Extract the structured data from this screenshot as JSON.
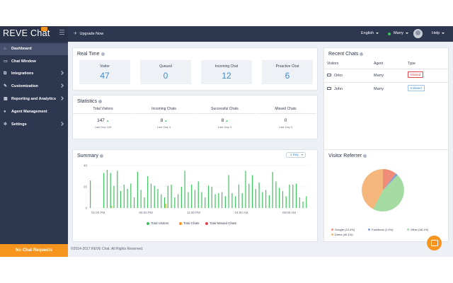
{
  "brand": {
    "name": "REVE Chat"
  },
  "sidebar": {
    "items": [
      {
        "label": "Dashboard",
        "icon": "home-icon"
      },
      {
        "label": "Chat Window",
        "icon": "chat-icon"
      },
      {
        "label": "Integrations",
        "icon": "plug-icon"
      },
      {
        "label": "Customization",
        "icon": "brush-icon"
      },
      {
        "label": "Reporting and Analytics",
        "icon": "chart-icon"
      },
      {
        "label": "Agent Management",
        "icon": "user-icon"
      },
      {
        "label": "Settings",
        "icon": "gear-icon"
      }
    ],
    "no_chat": "No Chat Requests"
  },
  "topbar": {
    "upgrade": "Upgrade Now",
    "language": "English",
    "agent": "Marry",
    "help": "Help"
  },
  "realtime": {
    "title": "Real Time",
    "boxes": [
      {
        "label": "Visitor",
        "value": "47"
      },
      {
        "label": "Queued",
        "value": "0"
      },
      {
        "label": "Incoming Chat",
        "value": "12"
      },
      {
        "label": "Proactive Chat",
        "value": "6"
      }
    ]
  },
  "statistics": {
    "title": "Statistics",
    "cols": [
      {
        "label": "Total Visitors",
        "value": "147",
        "sub": "Last Day 105"
      },
      {
        "label": "Incoming Chats",
        "value": "8",
        "sub": "Last Day 4"
      },
      {
        "label": "Successful Chats",
        "value": "8",
        "sub": "Last Day 4"
      },
      {
        "label": "Missed Chats",
        "value": "0",
        "sub": "Last Day 0"
      }
    ],
    "arrow": "▲"
  },
  "summary": {
    "title": "Summary",
    "range": "1 Day",
    "legend": [
      {
        "label": "Total Visitors",
        "color": "#3cc45c"
      },
      {
        "label": "Total Chats",
        "color": "#f7941d"
      },
      {
        "label": "Total Missed Chats",
        "color": "#e0454b"
      }
    ]
  },
  "chart_data": {
    "type": "bar",
    "title": "Summary",
    "xlabel": "",
    "ylabel": "",
    "ylim": [
      0,
      40
    ],
    "yticks": [
      "0",
      "20",
      "40"
    ],
    "xticks": [
      "01:00 PM",
      "06:00 PM",
      "11:00 PM",
      "04:00 AM",
      "09:00 AM"
    ],
    "series": [
      {
        "name": "Total Visitors",
        "color": "#3cc45c",
        "values": [
          26,
          0,
          0,
          0,
          33,
          36,
          33,
          21,
          35,
          16,
          22,
          18,
          23,
          10,
          34,
          17,
          10,
          30,
          23,
          21,
          18,
          13,
          10,
          21,
          22,
          10,
          13,
          20,
          35,
          15,
          22,
          17,
          25,
          15,
          10,
          21,
          20,
          13,
          14,
          15,
          11,
          31,
          14,
          11,
          22,
          14,
          35,
          23,
          31,
          18,
          24,
          15,
          17,
          12,
          34,
          25,
          19,
          16,
          11,
          22,
          22,
          23,
          10,
          6,
          11
        ]
      },
      {
        "name": "Total Chats",
        "color": "#f7941d",
        "values": [
          0,
          0,
          0,
          0,
          0,
          0,
          2,
          0,
          0,
          0,
          0,
          0,
          0,
          0,
          0,
          0,
          0,
          0,
          0,
          0,
          0,
          0,
          4,
          0,
          0,
          0,
          0,
          0,
          0,
          0,
          0,
          0,
          0,
          0,
          0,
          0,
          0,
          0,
          0,
          0,
          0,
          0,
          0,
          0,
          0,
          0,
          0,
          0,
          0,
          0,
          0,
          0,
          0,
          0,
          0,
          0,
          0,
          0,
          0,
          0,
          0,
          0,
          0,
          0,
          0
        ]
      },
      {
        "name": "Total Missed Chats",
        "color": "#e0454b",
        "values": [
          0,
          0,
          0,
          0,
          0,
          0,
          0,
          0,
          0,
          0,
          0,
          0,
          0,
          0,
          0,
          0,
          0,
          0,
          0,
          0,
          0,
          0,
          0,
          0,
          0,
          0,
          0,
          0,
          0,
          0,
          0,
          0,
          0,
          0,
          0,
          0,
          0,
          0,
          0,
          0,
          0,
          0,
          0,
          0,
          0,
          0,
          0,
          0,
          0,
          0,
          0,
          0,
          0,
          0,
          0,
          0,
          0,
          0,
          0,
          0,
          0,
          0,
          0,
          0,
          0
        ]
      }
    ]
  },
  "recent": {
    "title": "Recent Chats",
    "headers": [
      "Visitors",
      "Agent",
      "Type"
    ],
    "rows": [
      {
        "visitor": "Orko",
        "agent": "Marry",
        "type": "Missed",
        "kind": "missed"
      },
      {
        "visitor": "John",
        "agent": "Marry",
        "type": "Initiated",
        "kind": "initiated"
      }
    ]
  },
  "referrer": {
    "title": "Visitor Referrer",
    "legend": [
      {
        "label": "Google (10.4%)",
        "color": "#f08c78"
      },
      {
        "label": "Facebook (1.4%)",
        "color": "#7a9fd6"
      },
      {
        "label": "Other (48.1%)",
        "color": "#a3dba3"
      },
      {
        "label": "Direct (40.1%)",
        "color": "#f4b67a"
      }
    ]
  },
  "footer": "©2014-2017 REVE Chat. All Rights Reserved."
}
